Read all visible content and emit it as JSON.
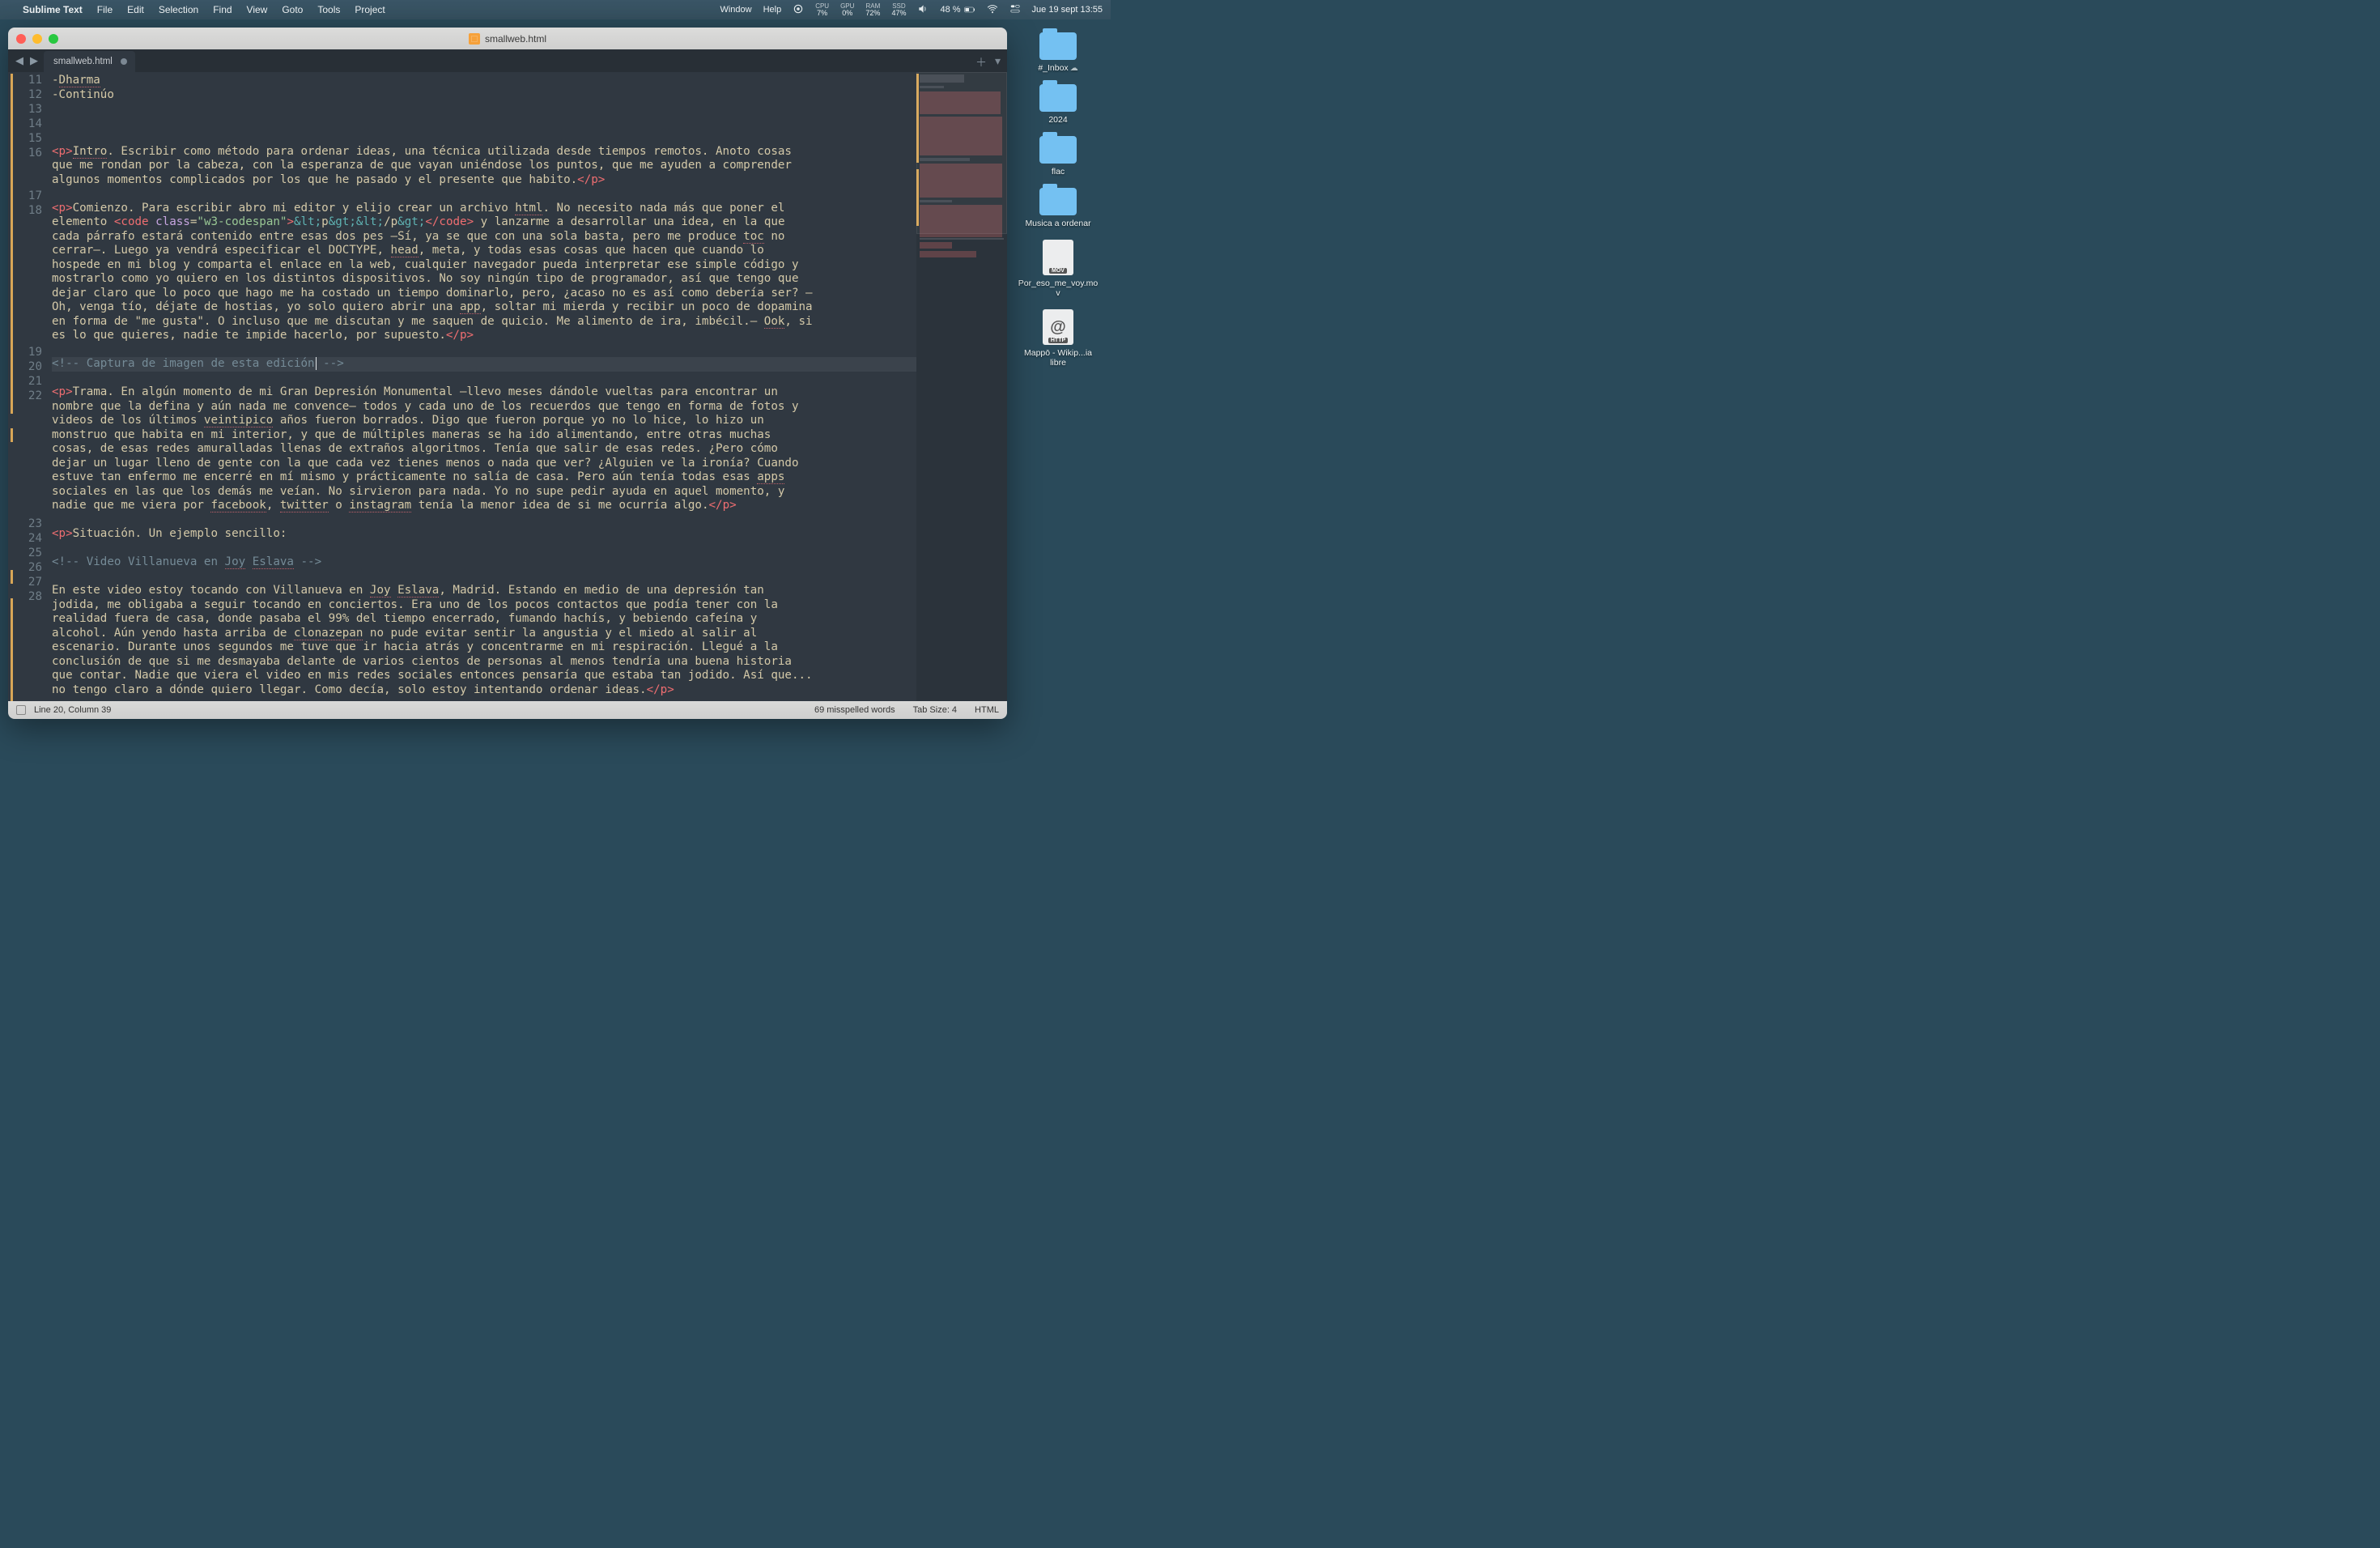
{
  "menubar": {
    "app": "Sublime Text",
    "items": [
      "File",
      "Edit",
      "Selection",
      "Find",
      "View",
      "Goto",
      "Tools",
      "Project"
    ],
    "right_items": [
      "Window",
      "Help"
    ],
    "cpu_label": "CPU",
    "cpu_val": "7%",
    "gpu_label": "GPU",
    "gpu_val": "0%",
    "ram_label": "RAM",
    "ram_val": "72%",
    "ssd_label": "SSD",
    "ssd_val": "47%",
    "battery": "48 %",
    "clock": "Jue 19 sept 13:55"
  },
  "desktop": {
    "items": [
      {
        "type": "folder",
        "label": "#_Inbox",
        "cloud": true
      },
      {
        "type": "folder",
        "label": "2024"
      },
      {
        "type": "folder",
        "label": "flac"
      },
      {
        "type": "folder",
        "label": "Musica a ordenar"
      },
      {
        "type": "mov",
        "label": "Por_eso_me_voy.mov"
      },
      {
        "type": "http",
        "label": "Mappō - Wikip...ia libre"
      }
    ]
  },
  "window": {
    "title": "smallweb.html",
    "tab": "smallweb.html"
  },
  "status": {
    "pos": "Line 20, Column 39",
    "spell": "69 misspelled words",
    "tabsize": "Tab Size: 4",
    "syntax": "HTML"
  },
  "code": {
    "lines": [
      {
        "n": 11,
        "html": "<span class='txt'>-<span class='sq'>Dharma</span></span>"
      },
      {
        "n": 12,
        "html": "<span class='txt'>-Continúo</span>"
      },
      {
        "n": 13,
        "html": ""
      },
      {
        "n": 14,
        "html": ""
      },
      {
        "n": 15,
        "html": ""
      },
      {
        "n": 16,
        "html": "<span class='tag'>&lt;p&gt;</span><span class='sq'>Intro</span>. Escribir como método para ordenar ideas, una técnica utilizada desde tiempos remotos. Anoto cosas que me rondan por la cabeza, con la esperanza de que vayan uniéndose los puntos, que me ayuden a comprender algunos momentos complicados por los que he pasado y el presente que habito.<span class='tag'>&lt;/p&gt;</span>"
      },
      {
        "n": 17,
        "html": ""
      },
      {
        "n": 18,
        "html": "<span class='tag'>&lt;p&gt;</span>Comienzo. Para escribir abro mi editor y elijo crear un archivo <span class='sq'>html</span>. No necesito nada más que poner el elemento <span class='tag'>&lt;code</span> <span class='attr'>class</span>=<span class='str'>\"w3-codespan\"</span><span class='tag'>&gt;</span><span class='ent'>&amp;lt;</span>p<span class='ent'>&amp;gt;&amp;lt;</span>/p<span class='ent'>&amp;gt;</span><span class='tag'>&lt;/code&gt;</span> y lanzarme a desarrollar una idea, en la que cada párrafo estará contenido entre esas dos pes –Sí, ya se que con una sola basta, pero me produce <span class='sq'>toc</span> no cerrar–. Luego ya vendrá especificar el DOCTYPE, <span class='sq'>head</span>, meta, y todas esas cosas que hacen que cuando lo hospede en mi blog y comparta el enlace en la web, cualquier navegador pueda interpretar ese simple código y mostrarlo como yo quiero en los distintos dispositivos. No soy ningún tipo de programador, así que tengo que dejar claro que lo poco que hago me ha costado un tiempo dominarlo, pero, ¿acaso no es así como debería ser? –Oh, venga tío, déjate de hostias, yo solo quiero abrir una <span class='sq'>app</span>, soltar mi mierda y recibir un poco de dopamina en forma de \"me gusta\". O incluso que me discutan y me saquen de quicio. Me alimento de ira, imbécil.– <span class='sq'>Ook</span>, si es lo que quieres, nadie te impide hacerlo, por supuesto.<span class='tag'>&lt;/p&gt;</span>"
      },
      {
        "n": 19,
        "html": ""
      },
      {
        "n": 20,
        "hl": true,
        "html": "<span class='com'>&lt;!-- Captura de imagen de esta edición<span class='curs'></span> --&gt;</span>"
      },
      {
        "n": 21,
        "html": ""
      },
      {
        "n": 22,
        "html": "<span class='tag'>&lt;p&gt;</span>Trama. En algún momento de mi Gran Depresión Monumental –llevo meses dándole vueltas para encontrar un nombre que la defina y aún nada me convence– todos y cada uno de los recuerdos que tengo en forma de fotos y videos de los últimos <span class='sq'>veintipico</span> años fueron borrados. Digo que fueron porque yo no lo hice, lo hizo un monstruo que habita en mi interior, y que de múltiples maneras se ha ido alimentando, entre otras muchas cosas, de esas redes amuralladas llenas de extraños algoritmos. Tenía que salir de esas redes. ¿Pero cómo dejar un lugar lleno de gente con la que cada vez tienes menos o nada que ver? ¿Alguien ve la ironía? Cuando estuve tan enfermo me encerré en mí mismo y prácticamente no salía de casa. Pero aún tenía todas esas <span class='sq'>apps</span> sociales en las que los demás me veían. No sirvieron para nada. Yo no supe pedir ayuda en aquel momento, y nadie que me viera por <span class='sq'>facebook</span>, <span class='sq'>twitter</span> o <span class='sq'>instagram</span> tenía la menor idea de si me ocurría algo.<span class='tag'>&lt;/p&gt;</span>"
      },
      {
        "n": 23,
        "html": ""
      },
      {
        "n": 24,
        "html": "<span class='tag'>&lt;p&gt;</span>Situación. Un ejemplo sencillo:"
      },
      {
        "n": 25,
        "html": ""
      },
      {
        "n": 26,
        "html": "<span class='com'>&lt;!-- Video Villanueva en <span style='border-bottom:1px dotted #bf616a'>Joy</span> <span style='border-bottom:1px dotted #bf616a'>Eslava</span> --&gt;</span>"
      },
      {
        "n": 27,
        "html": ""
      },
      {
        "n": 28,
        "html": "En este video estoy tocando con Villanueva en <span class='sq'>Joy</span> <span class='sq'>Eslava</span>, Madrid. Estando en medio de una depresión tan jodida, me obligaba a seguir tocando en conciertos. Era uno de los pocos contactos que podía tener con la realidad fuera de casa, donde pasaba el 99% del tiempo encerrado, fumando hachís, y bebiendo cafeína y alcohol. Aún yendo hasta arriba de <span class='sq'>clonazepan</span> no pude evitar sentir la angustia y el miedo al salir al escenario. Durante unos segundos me tuve que ir hacia atrás y concentrarme en mi respiración. Llegué a la conclusión de que si me desmayaba delante de varios cientos de personas al menos tendría una buena historia que contar. Nadie que viera el video en mis redes sociales entonces pensaría que estaba tan jodido. Así que... no tengo claro a dónde quiero llegar. Como decía, solo estoy intentando ordenar ideas.<span class='tag'>&lt;/p&gt;</span>"
      }
    ]
  }
}
